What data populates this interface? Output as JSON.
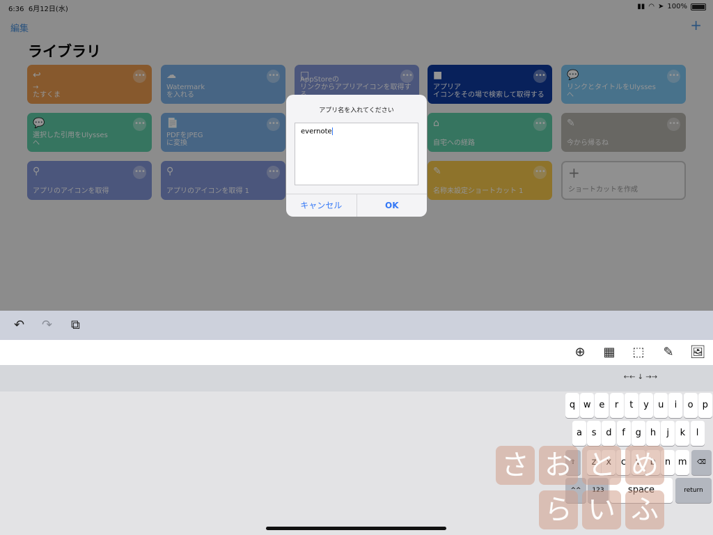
{
  "status_bar": {
    "time": "6:36",
    "date": "6月12日(水)",
    "battery": "100%"
  },
  "nav": {
    "edit": "編集",
    "add": "+"
  },
  "library": {
    "title": "ライブラリ",
    "tiles": [
      {
        "label": "→\nたすくま",
        "icon": "↩",
        "color": "#e8994e"
      },
      {
        "label": "Watermark\nを入れる",
        "icon": "☁",
        "color": "#7aaee3"
      },
      {
        "label": "AppStoreの\nリンクからアプリアイコンを取得する",
        "icon": "□",
        "color": "#8294d6"
      },
      {
        "label": "アプリア\nイコンをその場で検索して取得する",
        "icon": "■",
        "color": "#0f3a9e"
      },
      {
        "label": "リンクとタイトルをUlysses\nへ",
        "icon": "💬",
        "color": "#7cc4f0"
      },
      {
        "label": "選択した引用をUlysses\nへ",
        "icon": "💬",
        "color": "#5dcaa6"
      },
      {
        "label": "PDFをJPEG\nに変換",
        "icon": "📄",
        "color": "#7aaee3"
      },
      {
        "label": "自宅への経路",
        "icon": "⌂",
        "color": "#5dcaa6"
      },
      {
        "label": "今から帰るね",
        "icon": "✎",
        "color": "#b3b1ab"
      },
      {
        "label": "アプリのアイコンを取得",
        "icon": "⚲",
        "color": "#8294d6"
      },
      {
        "label": "アプリのアイコンを取得 1",
        "icon": "⚲",
        "color": "#8294d6"
      },
      {
        "label": "名称未設定ショートカット 1",
        "icon": "✎",
        "color": "#f4c64a"
      },
      {
        "label": "ショートカットを作成",
        "icon": "+",
        "color": "#f9f9f9"
      }
    ]
  },
  "dialog": {
    "title": "アプリ名を入れてください",
    "value": "evernote",
    "cancel": "キャンセル",
    "ok": "OK"
  },
  "toolbar": {
    "undo": "↶",
    "redo": "↷",
    "paste": "⧉"
  },
  "accessory": {
    "globe": "⊕",
    "grid": "▦",
    "frame": "⬚",
    "brush": "✎",
    "image": "🖼"
  },
  "arrows": "←← ↓ →→",
  "keyboard": {
    "row1": [
      "q",
      "w",
      "e",
      "r",
      "t",
      "y",
      "u",
      "i",
      "o",
      "p"
    ],
    "row2": [
      "a",
      "s",
      "d",
      "f",
      "g",
      "h",
      "j",
      "k",
      "l"
    ],
    "row3": [
      "z",
      "x",
      "c",
      "v",
      "b",
      "n",
      "m"
    ],
    "shift": "⇧",
    "delete": "⌫",
    "num": "123",
    "space": "space",
    "return": "return",
    "emoji": "^^"
  },
  "watermark": [
    "さ",
    "お",
    "と",
    "め",
    "ら",
    "い",
    "ふ"
  ]
}
